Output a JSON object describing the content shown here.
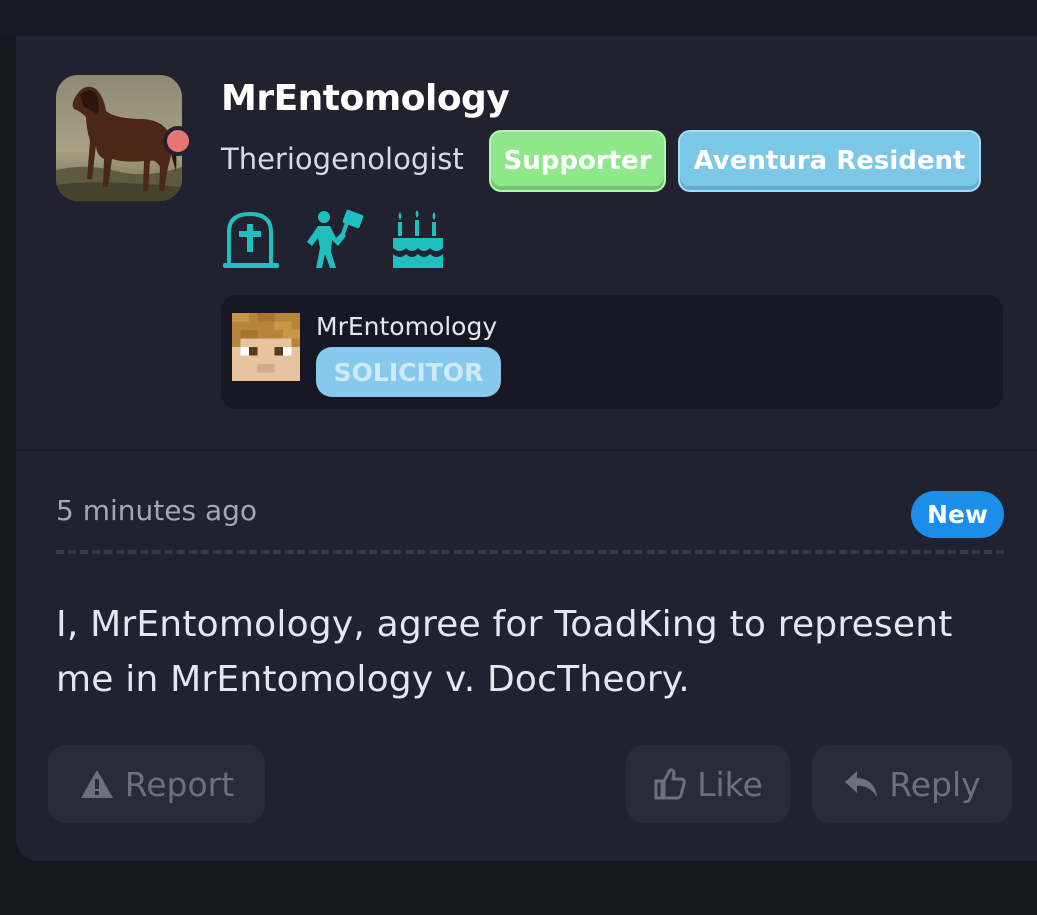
{
  "post": {
    "author": {
      "username": "MrEntomology",
      "title": "Theriogenologist",
      "status_color": "#e97474",
      "avatar": "horse-painting"
    },
    "badges": [
      {
        "label": "Supporter",
        "color": "#8ee88a"
      },
      {
        "label": "Aventura Resident",
        "color": "#7cc6e6"
      }
    ],
    "trophies": [
      "tombstone-icon",
      "protester-icon",
      "birthday-cake-icon"
    ],
    "linked_account": {
      "name": "MrEntomology",
      "role": "SOLICITOR",
      "avatar": "minecraft-head"
    },
    "timestamp": "5 minutes ago",
    "new_label": "New",
    "body": "I, MrEntomology, agree for ToadKing to represent me in MrEntomology v. DocTheory.",
    "actions": {
      "report": "Report",
      "like": "Like",
      "reply": "Reply"
    },
    "colors": {
      "accent_teal": "#1fbfbf",
      "new_blue": "#1a8ee8",
      "card_bg": "#21212f"
    }
  }
}
